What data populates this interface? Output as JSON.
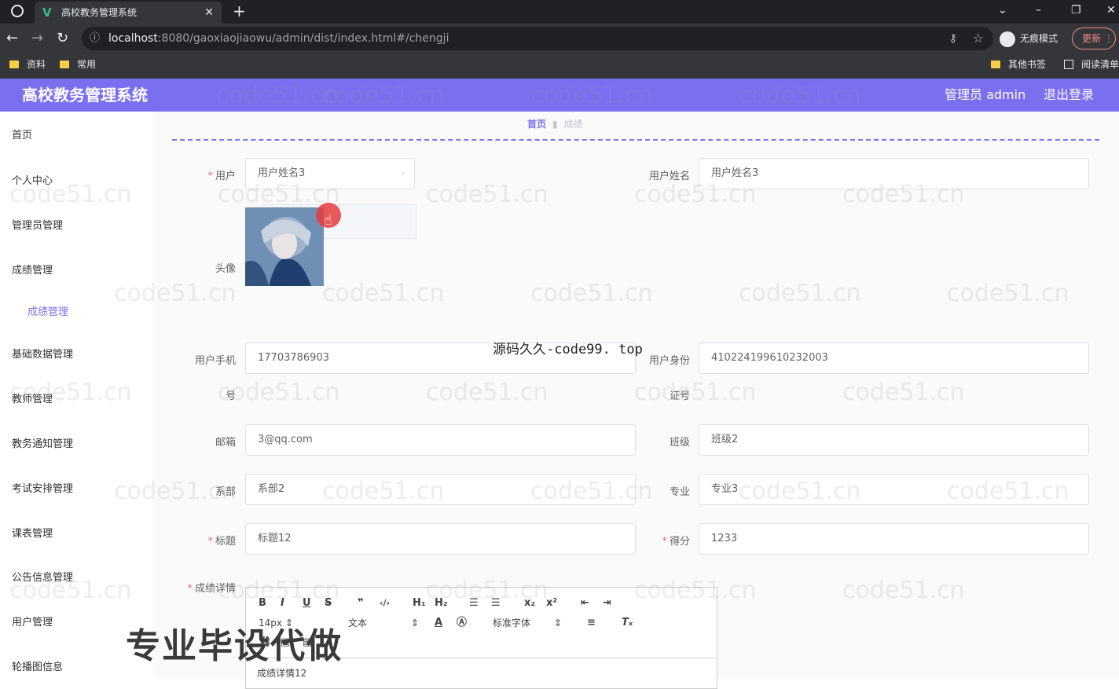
{
  "browser": {
    "tab_title": "高校教务管理系统",
    "tab_close": "✕",
    "new_tab": "+",
    "url_host": "localhost",
    "url_rest": ":8080/gaoxiaojiaowu/admin/dist/index.html#/chengji",
    "incognito_label": "无痕模式",
    "update_label": "更新",
    "bookmarks": [
      "资料",
      "常用"
    ],
    "bookmarks_right": [
      "其他书签",
      "阅读清单"
    ]
  },
  "header": {
    "title": "高校教务管理系统",
    "user": "管理员 admin",
    "logout": "退出登录"
  },
  "sidebar": {
    "items": [
      "首页",
      "个人中心",
      "管理员管理",
      "成绩管理",
      "基础数据管理",
      "教师管理",
      "教务通知管理",
      "考试安排管理",
      "课表管理",
      "公告信息管理",
      "用户管理",
      "轮播图信息"
    ],
    "sub_item": "成绩管理"
  },
  "breadcrumb": {
    "home": "首页",
    "current": "成绩"
  },
  "form": {
    "user_label": "用户",
    "user_value": "用户姓名3",
    "username_label": "用户姓名",
    "username_value": "用户姓名3",
    "avatar_label": "头像",
    "phone_label_1": "用户手机",
    "phone_label_2": "号",
    "phone_value": "17703786903",
    "id_label_1": "用户身份",
    "id_label_2": "证号",
    "id_value": "410224199610232003",
    "email_label": "邮箱",
    "email_value": "3@qq.com",
    "class_label": "班级",
    "class_value": "班级2",
    "dept_label": "系部",
    "dept_value": "系部2",
    "major_label": "专业",
    "major_value": "专业3",
    "title_label": "标题",
    "title_value": "标题12",
    "score_label": "得分",
    "score_value": "1233",
    "detail_label": "成绩详情",
    "detail_value": "成绩详情12"
  },
  "editor": {
    "size": "14px",
    "paragraph": "文本",
    "font": "标准字体"
  },
  "watermark": "code51.cn",
  "overlay_top": "源码久久-code99. top",
  "overlay_bottom": "专业毕设代做"
}
